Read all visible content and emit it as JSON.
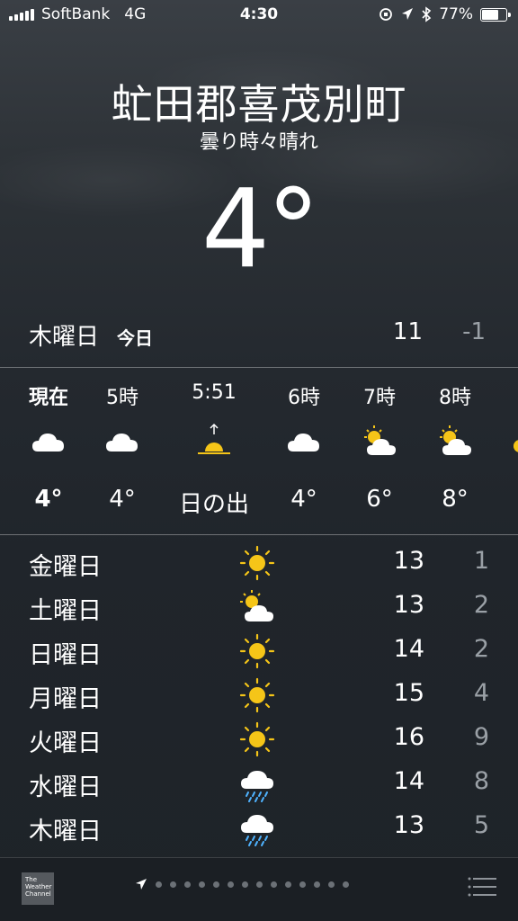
{
  "status_bar": {
    "carrier": "SoftBank",
    "network": "4G",
    "time": "4:30",
    "battery": "77%",
    "battery_level": 0.77
  },
  "location": {
    "city": "虻田郡喜茂別町",
    "condition": "曇り時々晴れ",
    "temperature": "4°"
  },
  "today": {
    "day": "木曜日",
    "tag": "今日",
    "high": "11",
    "low": "-1"
  },
  "hourly": [
    {
      "time": "現在",
      "icon": "cloud-icon",
      "temp": "4°",
      "emphasis": true
    },
    {
      "time": "5時",
      "icon": "cloud-icon",
      "temp": "4°",
      "emphasis": false
    },
    {
      "time": "5:51",
      "icon": "sunrise-icon",
      "temp": "日の出",
      "emphasis": false
    },
    {
      "time": "6時",
      "icon": "cloud-icon",
      "temp": "4°",
      "emphasis": false
    },
    {
      "time": "7時",
      "icon": "partly-cloudy-icon",
      "temp": "6°",
      "emphasis": false
    },
    {
      "time": "8時",
      "icon": "partly-cloudy-icon",
      "temp": "8°",
      "emphasis": false
    }
  ],
  "daily": [
    {
      "day": "金曜日",
      "icon": "sun-icon",
      "high": "13",
      "low": "1"
    },
    {
      "day": "土曜日",
      "icon": "partly-cloudy-icon",
      "high": "13",
      "low": "2"
    },
    {
      "day": "日曜日",
      "icon": "sun-icon",
      "high": "14",
      "low": "2"
    },
    {
      "day": "月曜日",
      "icon": "sun-icon",
      "high": "15",
      "low": "4"
    },
    {
      "day": "火曜日",
      "icon": "sun-icon",
      "high": "16",
      "low": "9"
    },
    {
      "day": "水曜日",
      "icon": "rain-icon",
      "high": "14",
      "low": "8"
    },
    {
      "day": "木曜日",
      "icon": "rain-icon",
      "high": "13",
      "low": "5"
    }
  ],
  "bottom_bar": {
    "logo_text": "The Weather Channel",
    "page_dots": 14
  },
  "colors": {
    "sun": "#f5c518",
    "cloud": "#ffffff",
    "rain": "#4fb3ff",
    "secondary_text": "#9aa0a6"
  }
}
